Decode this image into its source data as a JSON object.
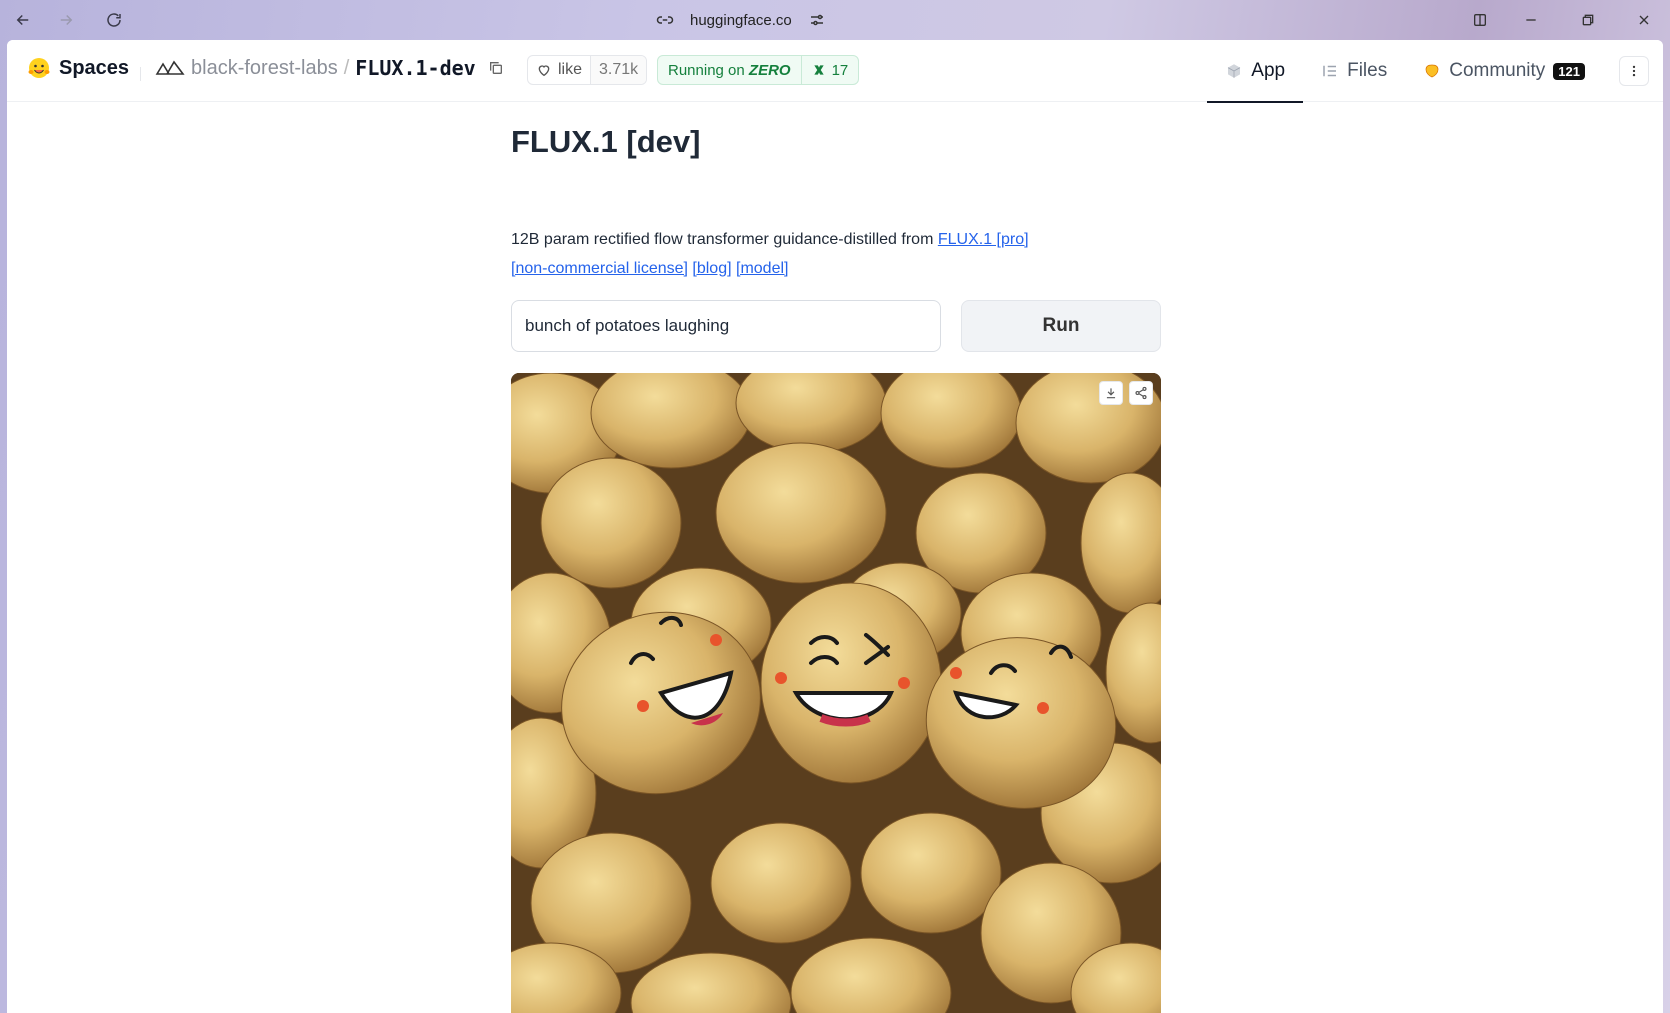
{
  "browser": {
    "url": "huggingface.co"
  },
  "header": {
    "brand": "Spaces",
    "org": "black-forest-labs",
    "separator": "/",
    "repo": "FLUX.1-dev",
    "like_label": "like",
    "like_count": "3.71k",
    "running_prefix": "Running on",
    "running_hw": "ZERO",
    "zero_count": "17",
    "tabs": [
      {
        "label": "App",
        "icon": "cube-icon"
      },
      {
        "label": "Files",
        "icon": "files-icon"
      },
      {
        "label": "Community",
        "icon": "community-icon",
        "badge": "121"
      }
    ]
  },
  "main": {
    "title": "FLUX.1 [dev]",
    "desc_text": "12B param rectified flow transformer guidance-distilled from ",
    "link_pro": "FLUX.1 [pro]",
    "link_license": "[non-commercial license]",
    "link_blog": "[blog]",
    "link_model": "[model]",
    "prompt_value": "bunch of potatoes laughing",
    "run_label": "Run"
  },
  "colors": {
    "accent_green": "#15803d",
    "link_blue": "#2563eb",
    "text_dark": "#1f2937"
  }
}
